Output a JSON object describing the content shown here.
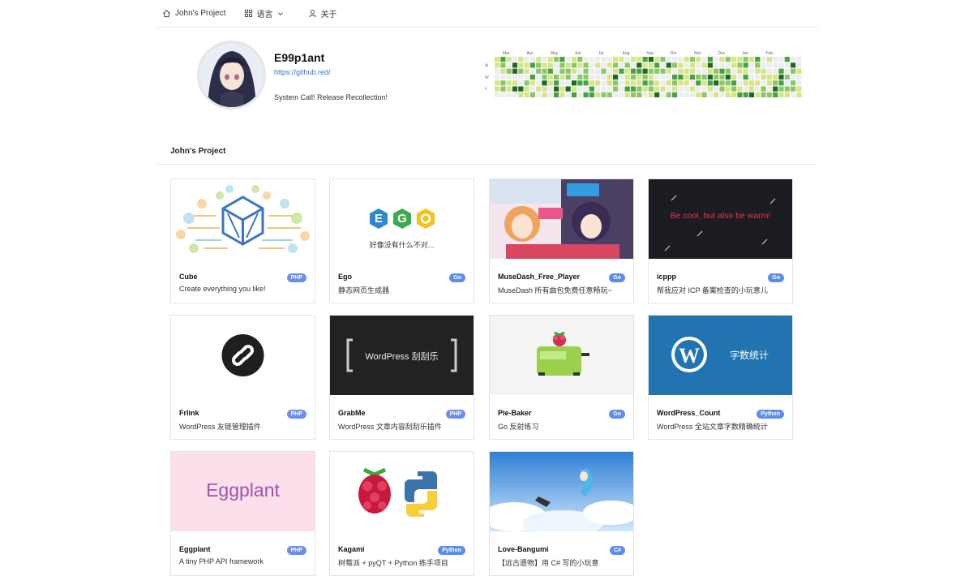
{
  "nav": {
    "home_label": "John's Project",
    "lang_label": "语言",
    "about_label": "关于"
  },
  "profile": {
    "name": "E99p1ant",
    "link": "https://github.red/",
    "bio": "System Call! Release Recollection!"
  },
  "heatmap": {
    "months": [
      "Mar",
      "Apr",
      "May",
      "Jun",
      "Jul",
      "Aug",
      "Sep",
      "Oct",
      "Nov",
      "Dec",
      "Jan",
      "Feb"
    ],
    "days": [
      "M",
      "W",
      "F"
    ],
    "colors": [
      "#ebedf0",
      "#d6e685",
      "#8cc665",
      "#44a340",
      "#1e6823"
    ]
  },
  "section": {
    "title": "John's Project"
  },
  "colors": {
    "php": "#6b8fe8",
    "go": "#5b8def",
    "python": "#5b8def",
    "csharp": "#5b8def",
    "link": "#3b73d1"
  },
  "projects": [
    {
      "title": "Cube",
      "desc": "Create everything you like!",
      "badge": "PHP"
    },
    {
      "title": "Ego",
      "desc": "静态网页生成器",
      "badge": "Go",
      "thumb_text": "好像没有什么不对..."
    },
    {
      "title": "MuseDash_Free_Player",
      "desc": "MuseDash 所有曲包免费任意畅玩~",
      "badge": "Go"
    },
    {
      "title": "icppp",
      "desc": "帮我应对 ICP 备案检查的小玩意儿",
      "badge": "Go",
      "thumb_text": "Be cool, but also be warm!"
    },
    {
      "title": "Frlink",
      "desc": "WordPress 友链管理插件",
      "badge": "PHP"
    },
    {
      "title": "GrabMe",
      "desc": "WordPress 文章内容刮刮乐插件",
      "badge": "PHP",
      "thumb_text": "WordPress 刮刮乐"
    },
    {
      "title": "Pie-Baker",
      "desc": "Go 反射练习",
      "badge": "Go"
    },
    {
      "title": "WordPress_Count",
      "desc": "WordPress 全站文章字数精确统计",
      "badge": "Python",
      "thumb_text": "字数统计"
    },
    {
      "title": "Eggplant",
      "desc": "A tiny PHP API framework",
      "badge": "PHP",
      "thumb_text": "Eggplant"
    },
    {
      "title": "Kagami",
      "desc": "树莓派 + pyQT + Python 练手项目",
      "badge": "Python"
    },
    {
      "title": "Love-Bangumi",
      "desc": "【远古遗物】用 C# 写的小玩意",
      "badge": "C#"
    }
  ]
}
